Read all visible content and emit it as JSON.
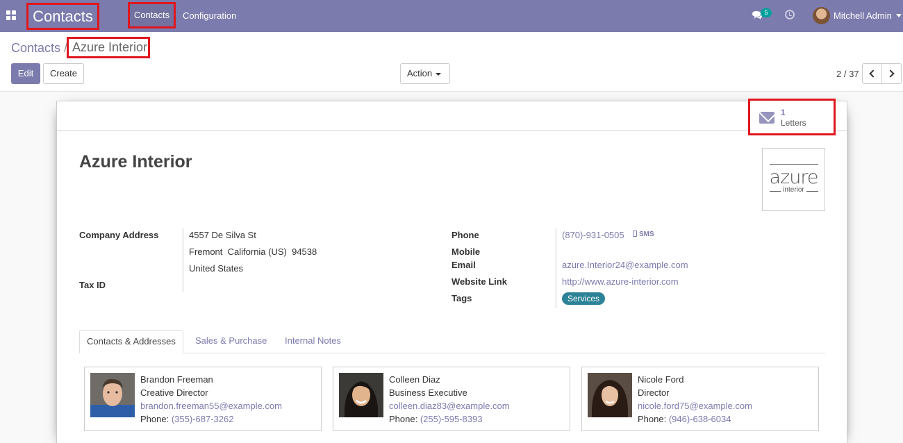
{
  "navbar": {
    "apps_icon": "apps-grid-icon",
    "brand": "Contacts",
    "menu": [
      {
        "label": "Contacts"
      },
      {
        "label": "Configuration"
      }
    ],
    "chat_icon": "chat-icon",
    "chat_count": "5",
    "activity_icon": "clock-icon",
    "user_name": "Mitchell Admin"
  },
  "breadcrumb": {
    "root": "Contacts",
    "separator": "/",
    "current": "Azure Interior"
  },
  "toolbar": {
    "edit_label": "Edit",
    "create_label": "Create",
    "action_label": "Action"
  },
  "pager": {
    "value": "2 / 37"
  },
  "smart_button": {
    "value": "1",
    "label": "Letters",
    "icon": "envelope-icon"
  },
  "record": {
    "name": "Azure Interior",
    "logo": {
      "word": "azure",
      "sub": "interior"
    },
    "left_fields": {
      "company_address_label": "Company Address",
      "street": "4557 De Silva St",
      "city_line": "Fremont  California (US)  94538",
      "country": "United States",
      "tax_id_label": "Tax ID"
    },
    "right_fields": {
      "phone_label": "Phone",
      "phone": "(870)-931-0505",
      "sms_label": "SMS",
      "mobile_label": "Mobile",
      "email_label": "Email",
      "email": "azure.Interior24@example.com",
      "website_label": "Website Link",
      "website": "http://www.azure-interior.com",
      "tags_label": "Tags",
      "tag": "Services"
    }
  },
  "tabs": [
    {
      "label": "Contacts & Addresses",
      "active": true
    },
    {
      "label": "Sales & Purchase",
      "active": false
    },
    {
      "label": "Internal Notes",
      "active": false
    }
  ],
  "contacts": [
    {
      "name": "Brandon Freeman",
      "function": "Creative Director",
      "email": "brandon.freeman55@example.com",
      "phone_label": "Phone:",
      "phone": "(355)-687-3262"
    },
    {
      "name": "Colleen Diaz",
      "function": "Business Executive",
      "email": "colleen.diaz83@example.com",
      "phone_label": "Phone:",
      "phone": "(255)-595-8393"
    },
    {
      "name": "Nicole Ford",
      "function": "Director",
      "email": "nicole.ford75@example.com",
      "phone_label": "Phone:",
      "phone": "(946)-638-6034"
    }
  ],
  "colors": {
    "brand": "#7c7bad",
    "highlight": "#e0161d",
    "tag": "#2c8397",
    "badge": "#00a09d"
  }
}
